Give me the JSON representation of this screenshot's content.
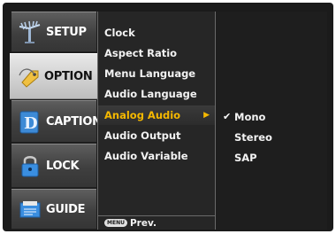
{
  "sidebar": {
    "items": [
      {
        "label": "SETUP",
        "icon": "satellite-antenna-icon",
        "active": false
      },
      {
        "label": "OPTION",
        "icon": "tag-icon",
        "active": true
      },
      {
        "label": "CAPTION",
        "icon": "caption-icon",
        "active": false
      },
      {
        "label": "LOCK",
        "icon": "padlock-icon",
        "active": false
      },
      {
        "label": "GUIDE",
        "icon": "guide-document-icon",
        "active": false
      }
    ]
  },
  "menu": {
    "items": [
      {
        "label": "Clock"
      },
      {
        "label": "Aspect Ratio"
      },
      {
        "label": "Menu Language"
      },
      {
        "label": "Audio Language"
      },
      {
        "label": "Analog Audio",
        "selected": true
      },
      {
        "label": "Audio Output"
      },
      {
        "label": "Audio Variable"
      }
    ],
    "footer_button": "MENU",
    "footer_label": "Prev."
  },
  "options": {
    "items": [
      {
        "label": "Mono",
        "checked": true
      },
      {
        "label": "Stereo",
        "checked": false
      },
      {
        "label": "SAP",
        "checked": false
      }
    ]
  },
  "colors": {
    "highlight": "#f5b800",
    "background": "#1b1b1b"
  }
}
